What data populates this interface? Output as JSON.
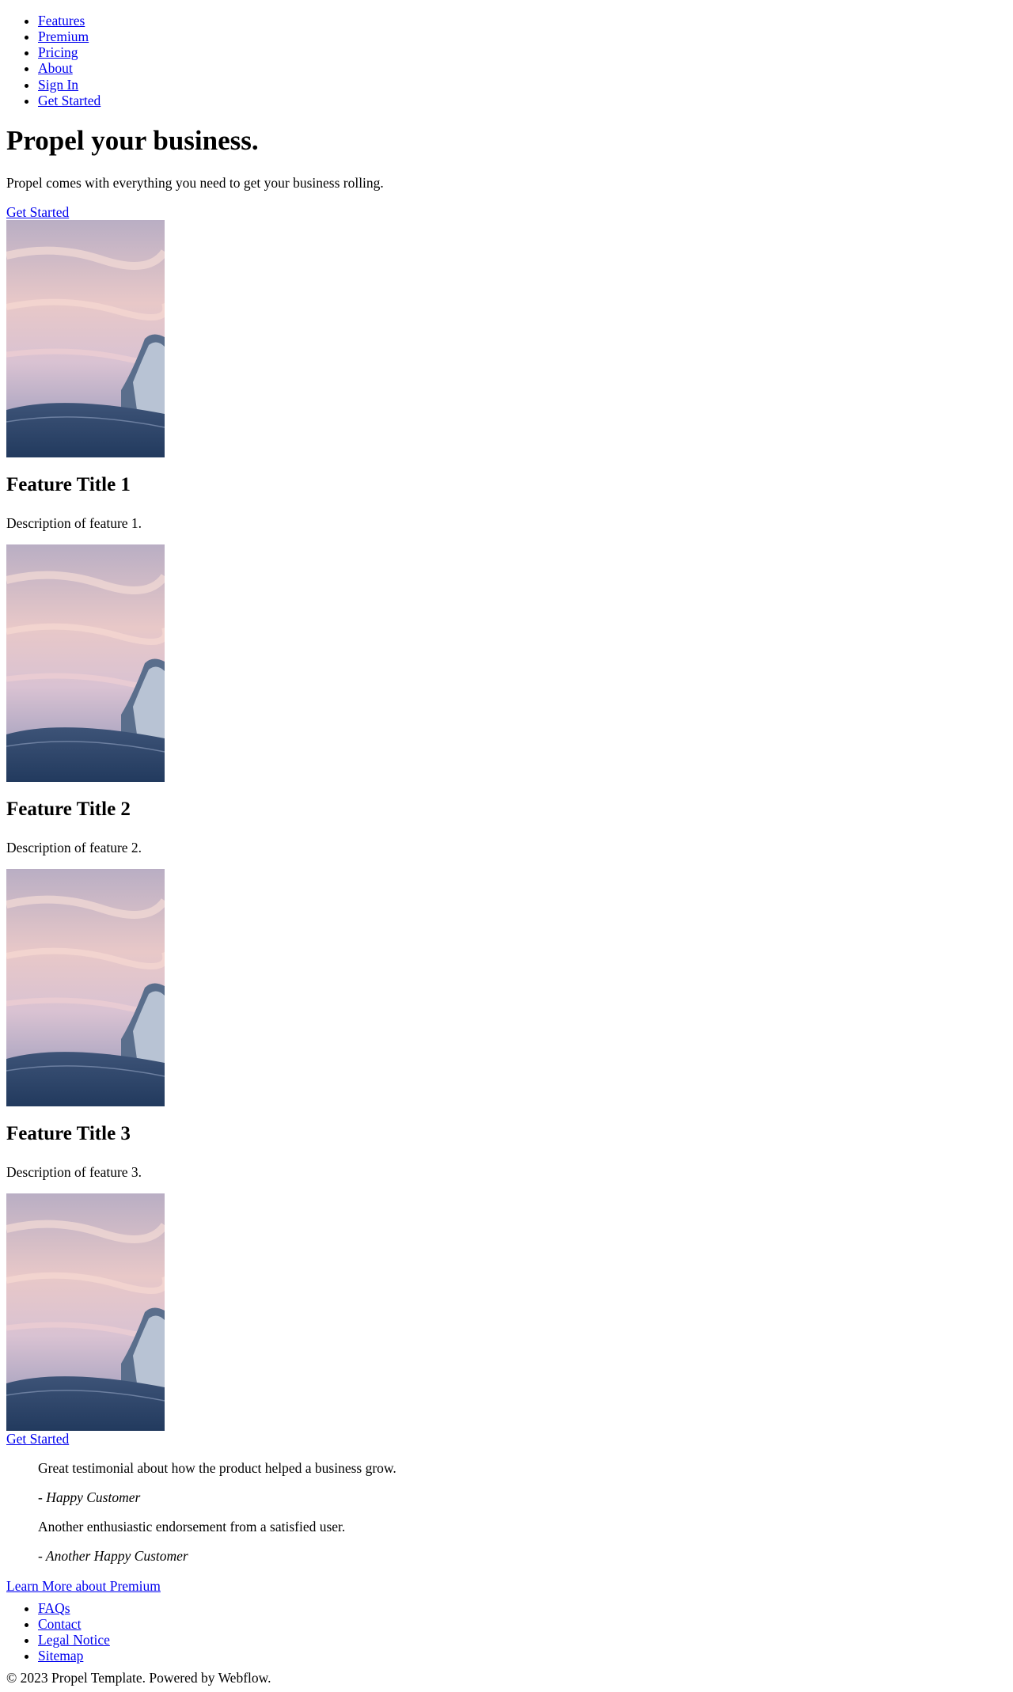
{
  "nav": {
    "items": [
      {
        "label": "Features"
      },
      {
        "label": "Premium"
      },
      {
        "label": "Pricing"
      },
      {
        "label": "About"
      },
      {
        "label": "Sign In"
      },
      {
        "label": "Get Started"
      }
    ]
  },
  "hero": {
    "title": "Propel your business.",
    "subtitle": "Propel comes with everything you need to get your business rolling.",
    "cta_label": "Get Started"
  },
  "features": [
    {
      "title": "Feature Title 1",
      "description": "Description of feature 1."
    },
    {
      "title": "Feature Title 2",
      "description": "Description of feature 2."
    },
    {
      "title": "Feature Title 3",
      "description": "Description of feature 3."
    }
  ],
  "bottom_cta_label": "Get Started",
  "testimonials": [
    {
      "quote": "Great testimonial about how the product helped a business grow.",
      "author": "- Happy Customer"
    },
    {
      "quote": "Another enthusiastic endorsement from a satisfied user.",
      "author": "- Another Happy Customer"
    }
  ],
  "premium_link_label": "Learn More about Premium",
  "footer": {
    "links": [
      {
        "label": "FAQs"
      },
      {
        "label": "Contact"
      },
      {
        "label": "Legal Notice"
      },
      {
        "label": "Sitemap"
      }
    ],
    "copyright": "© 2023 Propel Template. Powered by Webflow."
  },
  "colors": {
    "link": "#0000ee",
    "text": "#000000",
    "background": "#ffffff"
  }
}
